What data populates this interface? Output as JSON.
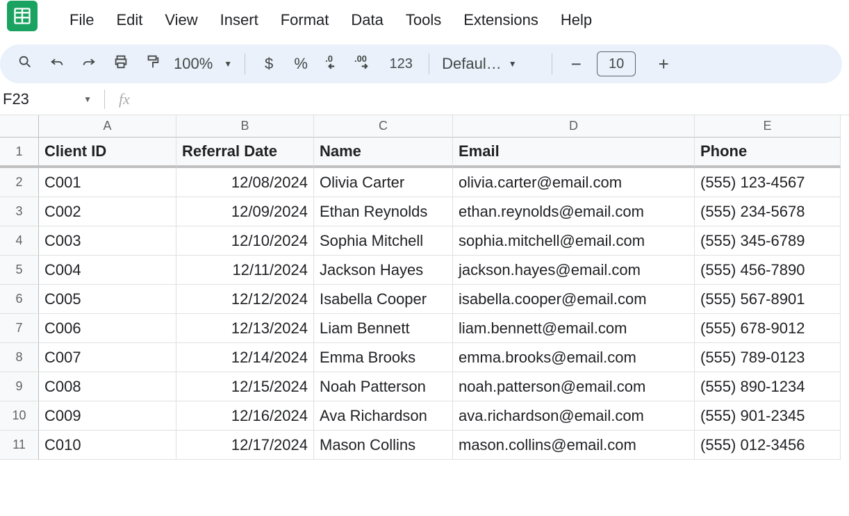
{
  "menu": [
    "File",
    "Edit",
    "View",
    "Insert",
    "Format",
    "Data",
    "Tools",
    "Extensions",
    "Help"
  ],
  "toolbar": {
    "zoom": "100%",
    "number_format": "123",
    "font_name": "Defaul…",
    "font_size": "10"
  },
  "name_box": "F23",
  "columns": [
    "A",
    "B",
    "C",
    "D",
    "E"
  ],
  "headers": [
    "Client ID",
    "Referral Date",
    "Name",
    "Email",
    "Phone"
  ],
  "rows": [
    {
      "num": "1"
    },
    {
      "num": "2",
      "cells": [
        "C001",
        "12/08/2024",
        "Olivia Carter",
        "olivia.carter@email.com",
        "(555) 123-4567"
      ]
    },
    {
      "num": "3",
      "cells": [
        "C002",
        "12/09/2024",
        "Ethan Reynolds",
        "ethan.reynolds@email.com",
        "(555) 234-5678"
      ]
    },
    {
      "num": "4",
      "cells": [
        "C003",
        "12/10/2024",
        "Sophia Mitchell",
        "sophia.mitchell@email.com",
        "(555) 345-6789"
      ]
    },
    {
      "num": "5",
      "cells": [
        "C004",
        "12/11/2024",
        "Jackson Hayes",
        "jackson.hayes@email.com",
        "(555) 456-7890"
      ]
    },
    {
      "num": "6",
      "cells": [
        "C005",
        "12/12/2024",
        "Isabella Cooper",
        "isabella.cooper@email.com",
        "(555) 567-8901"
      ]
    },
    {
      "num": "7",
      "cells": [
        "C006",
        "12/13/2024",
        "Liam Bennett",
        "liam.bennett@email.com",
        "(555) 678-9012"
      ]
    },
    {
      "num": "8",
      "cells": [
        "C007",
        "12/14/2024",
        "Emma Brooks",
        "emma.brooks@email.com",
        "(555) 789-0123"
      ]
    },
    {
      "num": "9",
      "cells": [
        "C008",
        "12/15/2024",
        "Noah Patterson",
        "noah.patterson@email.com",
        "(555) 890-1234"
      ]
    },
    {
      "num": "10",
      "cells": [
        "C009",
        "12/16/2024",
        "Ava Richardson",
        "ava.richardson@email.com",
        "(555) 901-2345"
      ]
    },
    {
      "num": "11",
      "cells": [
        "C010",
        "12/17/2024",
        "Mason Collins",
        "mason.collins@email.com",
        "(555) 012-3456"
      ]
    }
  ]
}
